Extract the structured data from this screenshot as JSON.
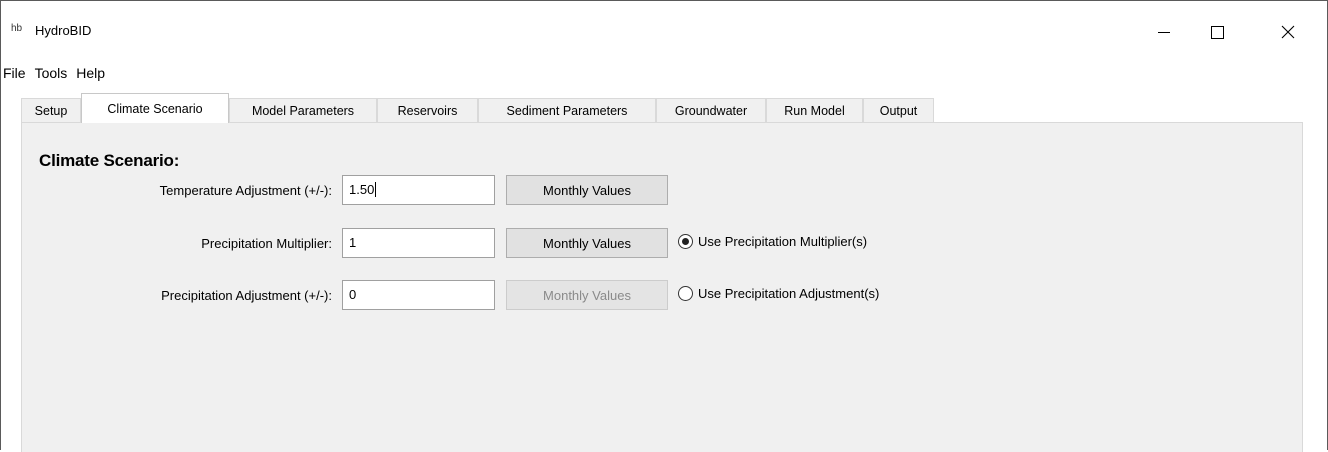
{
  "window": {
    "icon_text": "hb",
    "title": "HydroBID"
  },
  "menu": [
    "File",
    "Tools",
    "Help"
  ],
  "tabs": [
    {
      "label": "Setup"
    },
    {
      "label": "Climate Scenario",
      "active": true
    },
    {
      "label": "Model Parameters"
    },
    {
      "label": "Reservoirs"
    },
    {
      "label": "Sediment Parameters"
    },
    {
      "label": "Groundwater"
    },
    {
      "label": "Run Model"
    },
    {
      "label": "Output"
    }
  ],
  "climate": {
    "section_title": "Climate Scenario:",
    "temperature": {
      "label": "Temperature Adjustment (+/-):",
      "value": "1.50",
      "button": "Monthly Values"
    },
    "precip_multiplier": {
      "label": "Precipitation Multiplier:",
      "value": "1",
      "button": "Monthly Values",
      "radio_label": "Use Precipitation Multiplier(s)",
      "selected": true
    },
    "precip_adjustment": {
      "label": "Precipitation Adjustment (+/-):",
      "value": "0",
      "button": "Monthly Values",
      "button_disabled": true,
      "radio_label": "Use Precipitation Adjustment(s)",
      "selected": false
    }
  }
}
